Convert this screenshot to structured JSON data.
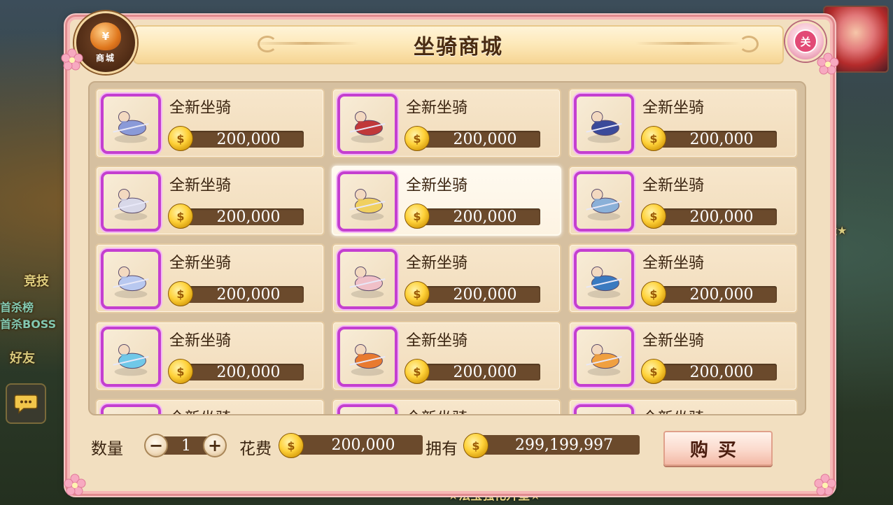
{
  "window": {
    "title": "坐骑商城",
    "badge_label": "商城",
    "badge_symbol": "¥",
    "close_label": "关"
  },
  "background": {
    "left_texts": [
      "竞技",
      "首杀榜",
      "首杀BOSS",
      "好友"
    ],
    "right_text": "运★",
    "bottom_text": "★法宝强化升星★"
  },
  "items": [
    {
      "name": "全新坐骑",
      "price": "200,000",
      "selected": false
    },
    {
      "name": "全新坐骑",
      "price": "200,000",
      "selected": false
    },
    {
      "name": "全新坐骑",
      "price": "200,000",
      "selected": false
    },
    {
      "name": "全新坐骑",
      "price": "200,000",
      "selected": false
    },
    {
      "name": "全新坐骑",
      "price": "200,000",
      "selected": true
    },
    {
      "name": "全新坐骑",
      "price": "200,000",
      "selected": false
    },
    {
      "name": "全新坐骑",
      "price": "200,000",
      "selected": false
    },
    {
      "name": "全新坐骑",
      "price": "200,000",
      "selected": false
    },
    {
      "name": "全新坐骑",
      "price": "200,000",
      "selected": false
    },
    {
      "name": "全新坐骑",
      "price": "200,000",
      "selected": false
    },
    {
      "name": "全新坐骑",
      "price": "200,000",
      "selected": false
    },
    {
      "name": "全新坐骑",
      "price": "200,000",
      "selected": false
    },
    {
      "name": "全新坐骑",
      "price": "",
      "selected": false
    },
    {
      "name": "全新坐骑",
      "price": "",
      "selected": false
    },
    {
      "name": "全新坐骑",
      "price": "",
      "selected": false
    }
  ],
  "purchase": {
    "quantity_label": "数量",
    "quantity": "1",
    "minus": "−",
    "plus": "+",
    "cost_label": "花费",
    "cost": "200,000",
    "owned_label": "拥有",
    "owned": "299,199,997",
    "buy_label": "购买"
  },
  "coin_glyph": "$",
  "colors": {
    "accent_border": "#c43fd0",
    "price_bar": "#6b4a2c",
    "panel": "#f2dfc0",
    "frame": "#f6b7b6"
  }
}
